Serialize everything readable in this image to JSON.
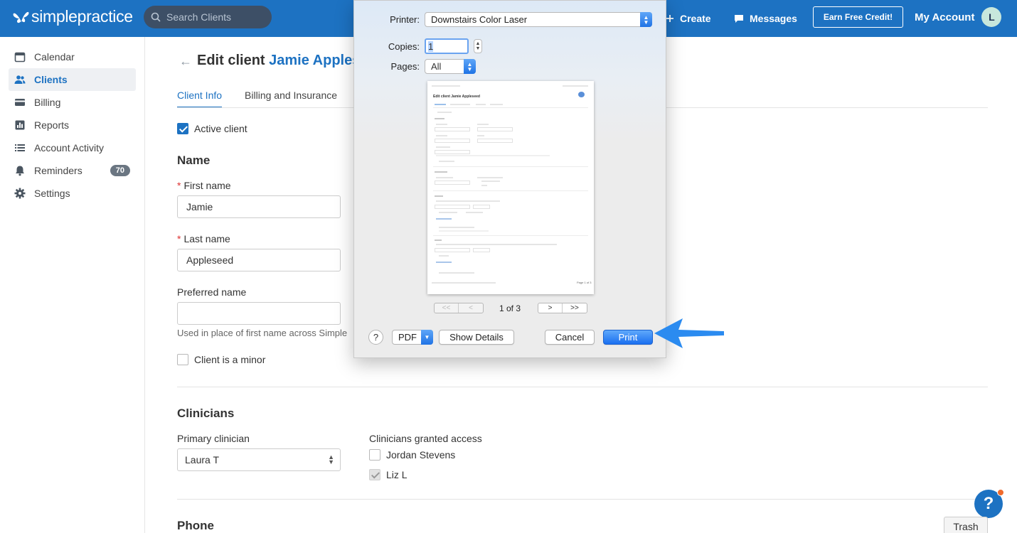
{
  "topbar": {
    "logo_text": "simplepractice",
    "search_placeholder": "Search Clients",
    "create_label": "Create",
    "messages_label": "Messages",
    "earn_label": "Earn Free Credit!",
    "account_label": "My Account",
    "avatar_initial": "L",
    "brand_color": "#1d72c2"
  },
  "sidebar": {
    "items": [
      {
        "label": "Calendar",
        "icon": "calendar-icon"
      },
      {
        "label": "Clients",
        "icon": "users-icon",
        "active": true
      },
      {
        "label": "Billing",
        "icon": "credit-card-icon"
      },
      {
        "label": "Reports",
        "icon": "bar-chart-icon"
      },
      {
        "label": "Account Activity",
        "icon": "list-icon"
      },
      {
        "label": "Reminders",
        "icon": "bell-icon",
        "badge": "70"
      },
      {
        "label": "Settings",
        "icon": "gear-icon"
      }
    ]
  },
  "main": {
    "title_prefix": "Edit client",
    "title_name": "Jamie Applese",
    "tabs": [
      "Client Info",
      "Billing and Insurance"
    ],
    "active_client_label": "Active client",
    "name_section": "Name",
    "first_name_label": "First name",
    "first_name_value": "Jamie",
    "last_name_label": "Last name",
    "last_name_value": "Appleseed",
    "preferred_name_label": "Preferred name",
    "preferred_name_value": "",
    "preferred_hint": "Used in place of first name across Simple",
    "minor_label": "Client is a minor",
    "clinicians_section": "Clinicians",
    "primary_clinician_label": "Primary clinician",
    "primary_clinician_value": "Laura T",
    "granted_access_label": "Clinicians granted access",
    "granted": [
      {
        "name": "Jordan Stevens",
        "checked": false
      },
      {
        "name": "Liz L",
        "checked": true
      }
    ],
    "phone_section": "Phone",
    "help_label": "?",
    "trash_label": "Trash"
  },
  "print_dialog": {
    "printer_label": "Printer:",
    "printer_value": "Downstairs Color Laser",
    "copies_label": "Copies:",
    "copies_value": "1",
    "pages_label": "Pages:",
    "pages_value": "All",
    "page_indicator": "1 of 3",
    "help_label": "?",
    "pdf_label": "PDF",
    "show_details_label": "Show Details",
    "cancel_label": "Cancel",
    "print_label": "Print",
    "preview": {
      "title": "Edit client Jamie Appleseed",
      "footer_page": "Page 1 of 3"
    }
  }
}
